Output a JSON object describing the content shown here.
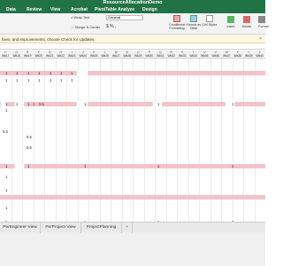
{
  "title": "ResourceAllocationDemo",
  "tabs": [
    "Data",
    "Review",
    "View",
    "Acrobat",
    "PivotTable Analyze",
    "Design"
  ],
  "ribbon": {
    "wrap_text": "Wrap Text",
    "number_format": "General",
    "merge_center": "Merge & Center",
    "conditional_formatting": "Conditional Formatting",
    "format_as_table": "Format as Table",
    "cell_styles": "Cell Styles",
    "insert": "Insert",
    "delete": "Delete",
    "format": "Format"
  },
  "message": "fixes, and improvements, choose Check for Updates.",
  "columns": [
    "C",
    "D",
    "E",
    "F",
    "G",
    "H",
    "I",
    "J",
    "K",
    "L",
    "M",
    "N",
    "O",
    "P",
    "Q",
    "R",
    "S",
    "T",
    "U",
    "V",
    "W",
    "X",
    "Y",
    "Z"
  ],
  "weeks": [
    "Wk17",
    "Wk18",
    "Wk19",
    "Wk20",
    "Wk21",
    "Wk22",
    "Wk23",
    "Wk24",
    "Wk25",
    "Wk26",
    "Wk27",
    "Wk28",
    "Wk29",
    "Wk30",
    "Wk31",
    "Wk32",
    "Wk33",
    "Wk34",
    "Wk35",
    "Wk36",
    "Wk37",
    "Wk38",
    "Wk39",
    "Wk40"
  ],
  "grid_values": {
    "r1": [
      "1",
      "1",
      "1",
      "1",
      "1",
      "1",
      "1"
    ],
    "r2": [
      "1",
      "1",
      "1",
      "1",
      "1",
      "1",
      "1"
    ],
    "r3": [
      "1",
      "1",
      "1",
      "1",
      "0.5",
      "1",
      "1",
      "1"
    ],
    "r4": [
      "1"
    ],
    "r5": [
      "0.5"
    ],
    "r6": [
      "0.5"
    ],
    "r7": [
      "0.5"
    ],
    "r8": [
      "1",
      "1",
      "1",
      "1",
      "1"
    ],
    "r9": [
      "1"
    ],
    "r10": [
      "1"
    ],
    "r11": [
      "1"
    ],
    "r12": [
      "1",
      "1",
      "1",
      "1"
    ]
  },
  "sheets": [
    "PerEngineer-View",
    "PerProject-View",
    "ProjectPlanning",
    "+"
  ]
}
